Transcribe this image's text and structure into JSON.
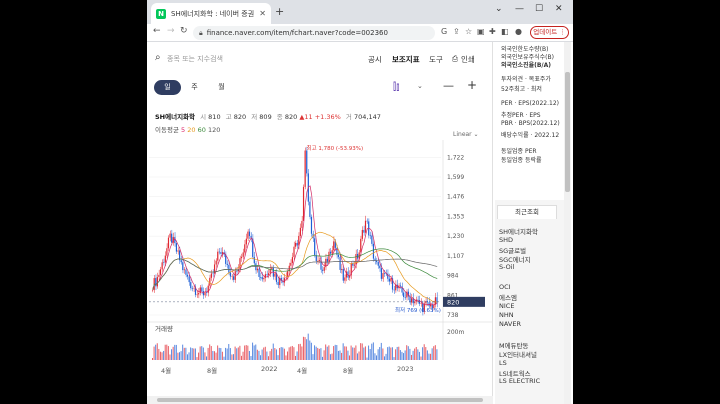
{
  "browser": {
    "tab_title": "SH에너지화학 : 네이버 증권",
    "favicon_letter": "N",
    "url": "finance.naver.com/item/fchart.naver?code=002360",
    "update_label": "업데이트"
  },
  "toolbar": {
    "search_placeholder": "종목 또는 지수검색",
    "links": [
      "공시",
      "보조지표",
      "도구",
      "인쇄"
    ],
    "periods": [
      "일",
      "주",
      "월"
    ]
  },
  "quote": {
    "name": "SH에너지화학",
    "open_label": "시",
    "open": "810",
    "high_label": "고",
    "high": "820",
    "low_label": "저",
    "low": "809",
    "close_label": "종",
    "close": "820",
    "change": "▲11",
    "change_pct": "+1.36%",
    "vol_label": "거",
    "volume": "704,147"
  },
  "moving_avg": {
    "label": "이동평균",
    "ma5": "5",
    "ma20": "20",
    "ma60": "60",
    "ma120": "120"
  },
  "scale_label": "Linear ⌄",
  "volume_label": "거래량",
  "colors": {
    "up": "#e0262f",
    "down": "#1e5fd6",
    "ma5": "#d22a66",
    "ma20": "#e79a1e",
    "ma60": "#3c8a3c",
    "ma120": "#666666",
    "accent": "#2f3d61"
  },
  "chart_data": {
    "type": "candlestick",
    "y_ticks": [
      "1,722",
      "1,599",
      "1,476",
      "1,353",
      "1,230",
      "1,107",
      "984",
      "861",
      "738"
    ],
    "ylim": [
      738,
      1780
    ],
    "x_ticks": [
      "4월",
      "8월",
      "2022",
      "4월",
      "8월",
      "2023"
    ],
    "current_price": "820",
    "annotations": {
      "max": "최고 1,780 (-53.93%)",
      "min": "최저 769 (6.63%)"
    },
    "volume_tick": "200m",
    "close_series": [
      930,
      950,
      1010,
      1080,
      1150,
      1230,
      1180,
      1120,
      1060,
      1000,
      960,
      920,
      900,
      880,
      870,
      890,
      930,
      1000,
      1080,
      1150,
      1100,
      1050,
      1000,
      980,
      1020,
      1100,
      1200,
      1300,
      1150,
      1050,
      990,
      970,
      1000,
      1050,
      1000,
      960,
      950,
      980,
      1020,
      1080,
      1150,
      1220,
      1300,
      1780,
      1400,
      1200,
      1100,
      1050,
      1000,
      1080,
      1150,
      1200,
      1100,
      1000,
      950,
      1000,
      1050,
      1080,
      1120,
      1250,
      1330,
      1240,
      1120,
      1050,
      1000,
      980,
      960,
      940,
      920,
      900,
      880,
      860,
      850,
      840,
      820,
      810,
      790,
      800,
      790,
      810,
      820
    ]
  },
  "sidebar": {
    "lines_top": [
      "외국인한도수량(B)",
      "외국인보유주식수(B)",
      "외국인소진율(B/A)"
    ],
    "lines_mid": [
      "투자의견 · 목표주가",
      "52주최고 · 최저"
    ],
    "lines_per": [
      "PER · EPS(2022.12)",
      "추정PER · EPS",
      "PBR · BPS(2022.12)",
      "배당수익률 · 2022.12"
    ],
    "lines_sector": [
      "동일업종 PER",
      "동일업종 등락률"
    ],
    "recent_tab": "최근조회",
    "recent": [
      "SH에너지화학",
      "SHD",
      "SG글로벌",
      "SGC에너지",
      "S-Oil"
    ],
    "recent2": [
      "OCI",
      "에스엠",
      "NICE",
      "NHN",
      "NAVER"
    ],
    "recent3": [
      "M에듀탄동",
      "LX인터내셔널",
      "LS",
      "LS네트웍스",
      "LS ELECTRIC"
    ]
  }
}
